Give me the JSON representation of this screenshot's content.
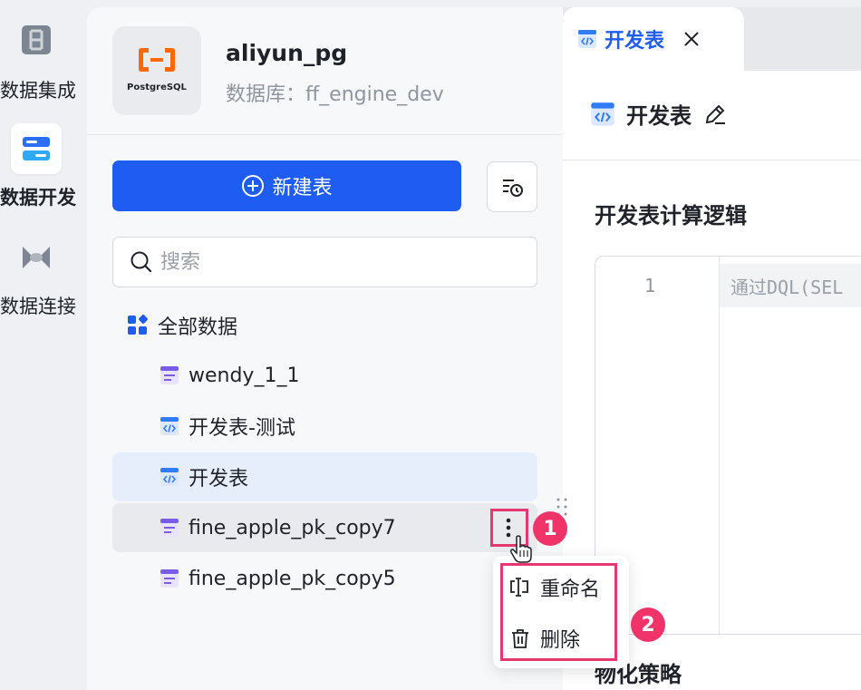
{
  "rail": {
    "items": [
      {
        "label": "数据集成",
        "icon": "data-integration-icon",
        "active": false
      },
      {
        "label": "数据开发",
        "icon": "data-development-icon",
        "active": true
      },
      {
        "label": "数据连接",
        "icon": "data-connection-icon",
        "active": false
      }
    ]
  },
  "database": {
    "name": "aliyun_pg",
    "subtitle": "数据库：ff_engine_dev",
    "logo_text": "PostgreSQL",
    "logo_icon": "aliyun-logo-icon"
  },
  "toolbar": {
    "new_table_label": "新建表",
    "history_icon": "history-icon"
  },
  "search": {
    "placeholder": "搜索",
    "value": ""
  },
  "tree": {
    "root_label": "全部数据",
    "items": [
      {
        "label": "wendy_1_1",
        "icon": "dataset-icon",
        "state": "normal"
      },
      {
        "label": "开发表-测试",
        "icon": "dev-table-icon",
        "state": "normal"
      },
      {
        "label": "开发表",
        "icon": "dev-table-icon",
        "state": "selected"
      },
      {
        "label": "fine_apple_pk_copy7",
        "icon": "dataset-icon",
        "state": "hovered"
      },
      {
        "label": "fine_apple_pk_copy5",
        "icon": "dataset-icon",
        "state": "normal"
      }
    ]
  },
  "context_menu": {
    "items": [
      {
        "label": "重命名",
        "icon": "rename-icon"
      },
      {
        "label": "删除",
        "icon": "delete-icon"
      }
    ]
  },
  "annotations": {
    "step1": "1",
    "step2": "2"
  },
  "tab": {
    "label": "开发表"
  },
  "content": {
    "title": "开发表",
    "section_title": "开发表计算逻辑",
    "line_number": "1",
    "code_placeholder": "通过DQL(SEL",
    "section2_title": "物化策略"
  },
  "colors": {
    "primary": "#1f5cf2",
    "annotation": "#e4386f",
    "selected_row": "#e6edfb",
    "hover_row": "#e9eaed",
    "aliyun_orange": "#ff6a00"
  }
}
